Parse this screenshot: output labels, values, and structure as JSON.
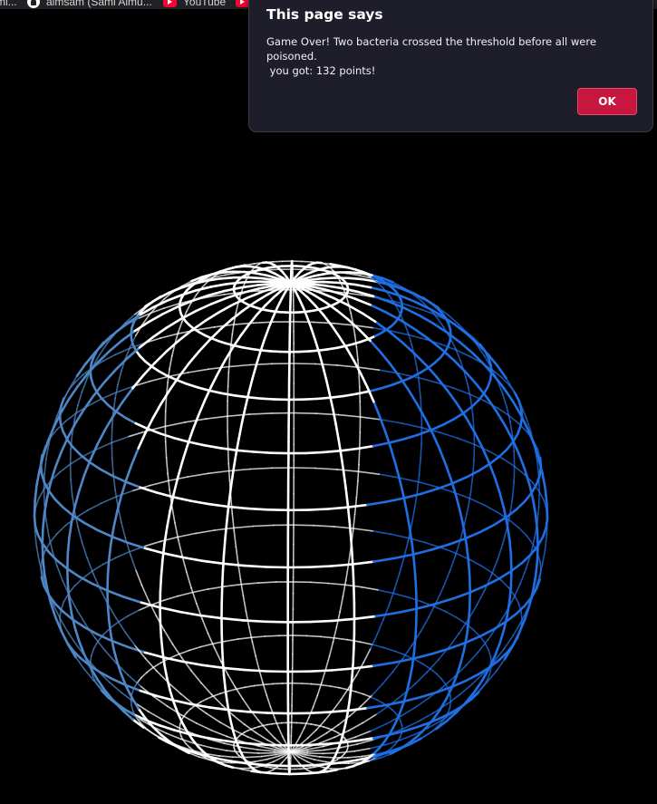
{
  "bookmarks_bar": {
    "items": [
      {
        "label": "mi...",
        "icon": "bookmark-icon"
      },
      {
        "label": "almsam (Sami Almu...",
        "icon": "github-icon"
      },
      {
        "label": "YouTube",
        "icon": "youtube-icon"
      },
      {
        "label": "",
        "icon": "youtube-icon"
      }
    ]
  },
  "game": {
    "sphere_colors": {
      "highlight": "#ffffff",
      "mid": "#4f86c6",
      "bacteria": "#1a6fe6",
      "background": "#000000"
    }
  },
  "alert": {
    "title": "This page says",
    "message": "Game Over! Two bacteria crossed the threshold before all were poisoned.\n you got: 132 points!",
    "ok_label": "OK",
    "colors": {
      "background": "#1e1d2a",
      "button": "#c8173e"
    }
  }
}
